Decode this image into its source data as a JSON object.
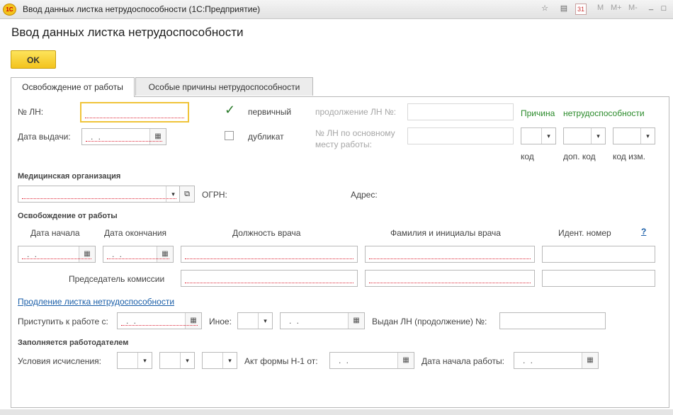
{
  "window": {
    "title": "Ввод данных листка нетрудоспособности  (1С:Предприятие)",
    "logo": "1С",
    "memory_buttons": [
      "M",
      "M+",
      "M-"
    ]
  },
  "page_title": "Ввод данных листка нетрудоспособности",
  "ok_label": "OK",
  "tabs": [
    {
      "label": "Освобождение от работы",
      "active": true
    },
    {
      "label": "Особые причины нетрудоспособности",
      "active": false
    }
  ],
  "top": {
    "ln_label": "№ ЛН:",
    "issue_date_label": "Дата выдачи:",
    "issue_date_value": ". .",
    "primary_label": "первичный",
    "primary_checked": true,
    "duplicate_label": "дубликат",
    "duplicate_checked": false,
    "continuation_label": "продолжение ЛН №:",
    "main_place_label_1": "№ ЛН по основному",
    "main_place_label_2": "месту работы:",
    "reason_label_1": "Причина",
    "reason_label_2": "нетрудоспособности",
    "code_label": "код",
    "extra_code_label": "доп. код",
    "code_change_label": "код изм."
  },
  "medical": {
    "section_title": "Медицинская организация",
    "ogrn_label": "ОГРН:",
    "address_label": "Адрес:"
  },
  "release": {
    "section_title": "Освобождение от работы",
    "col_start": "Дата начала",
    "col_end": "Дата окончания",
    "col_position": "Должность врача",
    "col_name": "Фамилия и инициалы врача",
    "col_id": "Идент.  номер",
    "help": "?",
    "date_placeholder": ". .",
    "chairman_label": "Председатель комиссии"
  },
  "extension": {
    "link": "Продление листка нетрудоспособности",
    "return_label": "Приступить к работе с:",
    "date_value": ". .",
    "other_label": "Иное:",
    "issued_label": "Выдан ЛН (продолжение) №:"
  },
  "employer": {
    "section_title": "Заполняется работодателем",
    "conditions_label": "Условия исчисления:",
    "act_label": "Акт формы Н-1 от:",
    "act_value": ". .",
    "start_work_label": "Дата начала работы:",
    "start_work_value": ". ."
  },
  "icons": {
    "calendar": "▦",
    "dropdown": "▾",
    "open": "⧉",
    "check": "✓",
    "star": "☆",
    "calc": "▤",
    "cal31": "31",
    "minimize": "_",
    "restore": "□",
    "close": "✕"
  }
}
